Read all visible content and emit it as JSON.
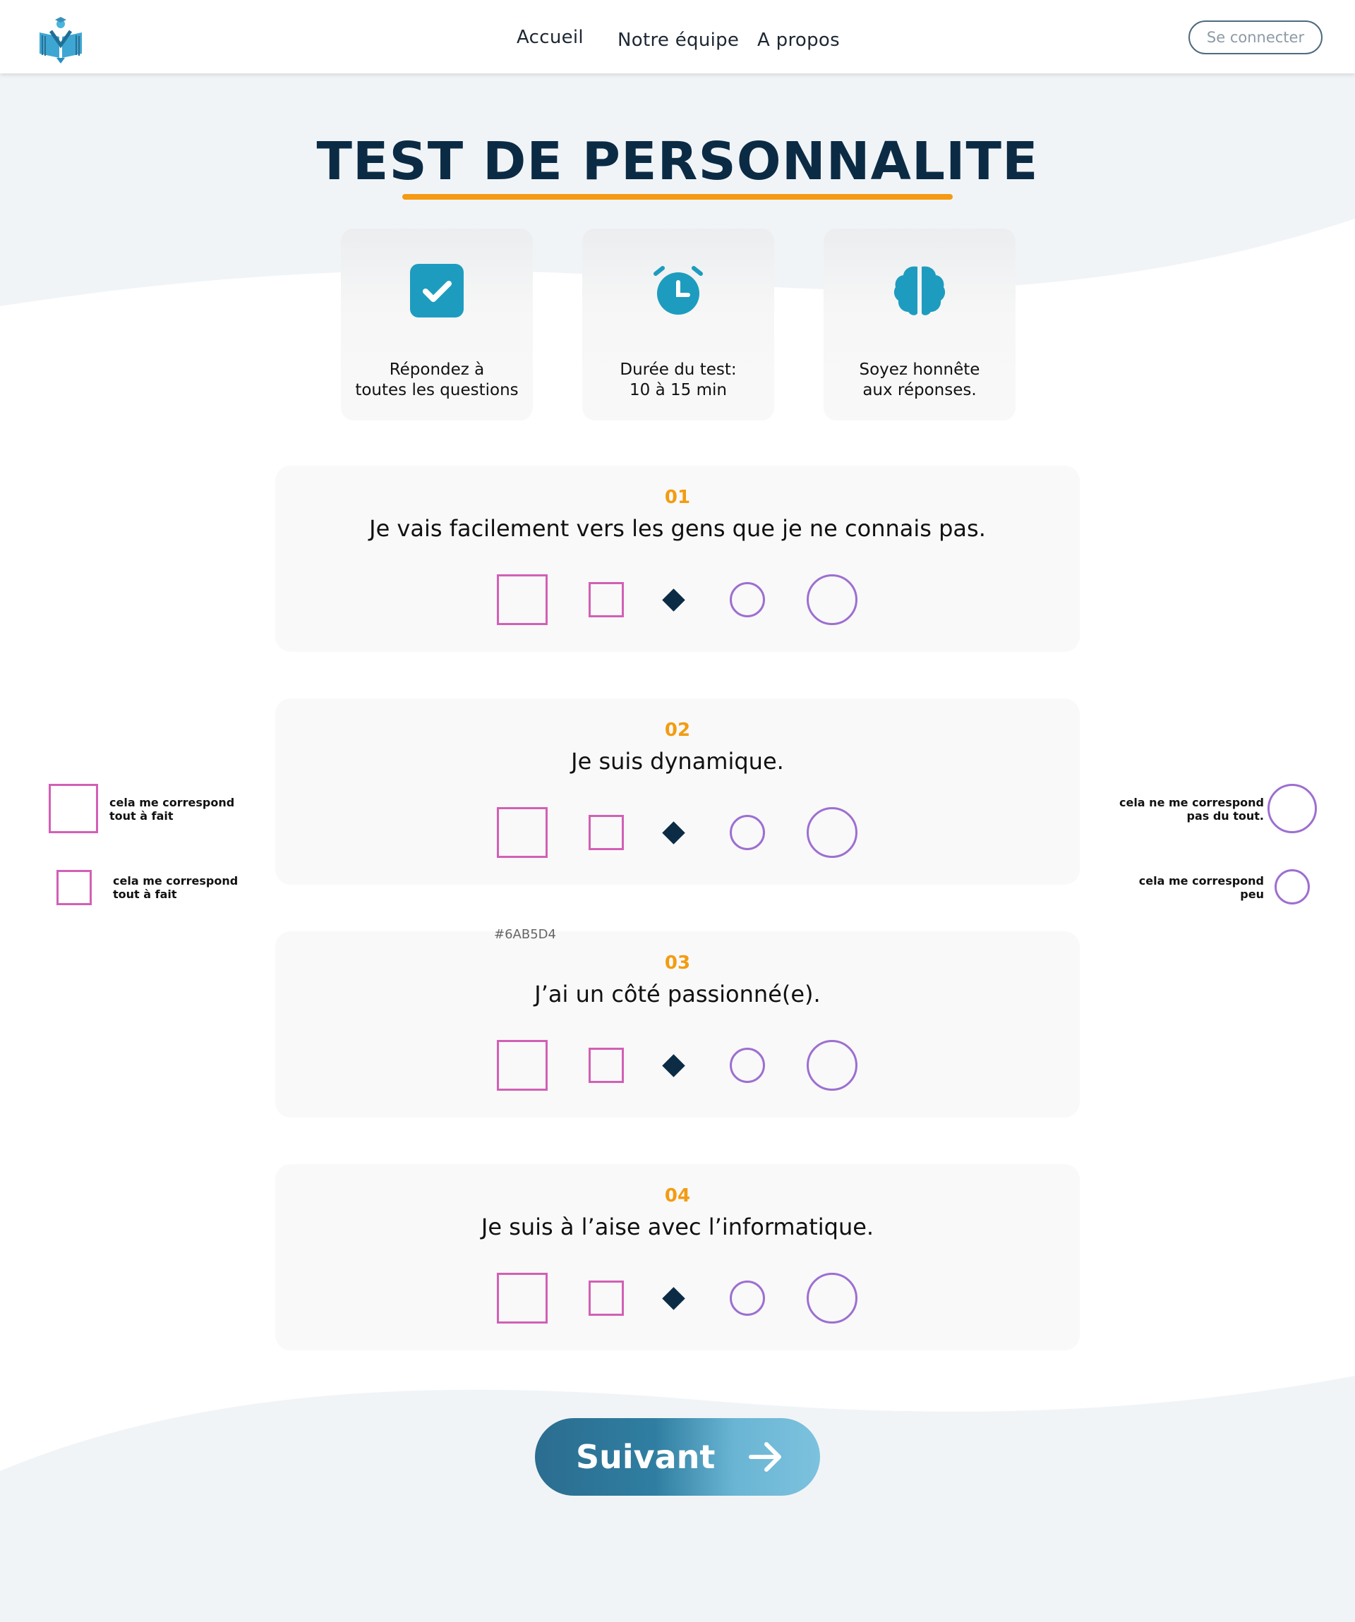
{
  "nav": {
    "logo_label": "logo",
    "links": [
      "Accueil",
      "Notre équipe",
      "A propos"
    ],
    "login_label": "Se connecter"
  },
  "page": {
    "title": "TEST DE PERSONNALITE"
  },
  "info_cards": [
    {
      "icon": "check-icon",
      "line1": "Répondez à",
      "line2": "toutes les questions"
    },
    {
      "icon": "alarm-clock-icon",
      "line1": "Durée du test:",
      "line2": "10 à 15 min"
    },
    {
      "icon": "brain-icon",
      "line1": "Soyez honnête",
      "line2": "aux réponses."
    }
  ],
  "questions": [
    {
      "number": "01",
      "text": "Je vais facilement vers les gens que je ne connais pas."
    },
    {
      "number": "02",
      "text": "Je suis dynamique."
    },
    {
      "number": "03",
      "text": "J’ai un côté passionné(e)."
    },
    {
      "number": "04",
      "text": "Je suis à l’aise avec l’informatique."
    }
  ],
  "legend": {
    "left_large_line1": "cela me correspond",
    "left_large_line2": "tout à fait",
    "left_small_line1": "cela me correspond",
    "left_small_line2": "tout à fait",
    "right_large_line1": "cela ne me correspond",
    "right_large_line2": "pas du tout.",
    "right_small_line1": "cela me correspond",
    "right_small_line2": "peu"
  },
  "annotation_hex": "#6AB5D4",
  "next_button": {
    "label": "Suivant"
  },
  "colors": {
    "title": "#0b2b45",
    "accent_orange": "#f59a12",
    "icon_teal": "#1e9cbf",
    "square_pink": "#d260b5",
    "circle_purple": "#9d6fd1",
    "diamond_navy": "#0c2c45",
    "button_blue_dark": "#2b6d90",
    "button_blue_light": "#6ab5d4"
  }
}
